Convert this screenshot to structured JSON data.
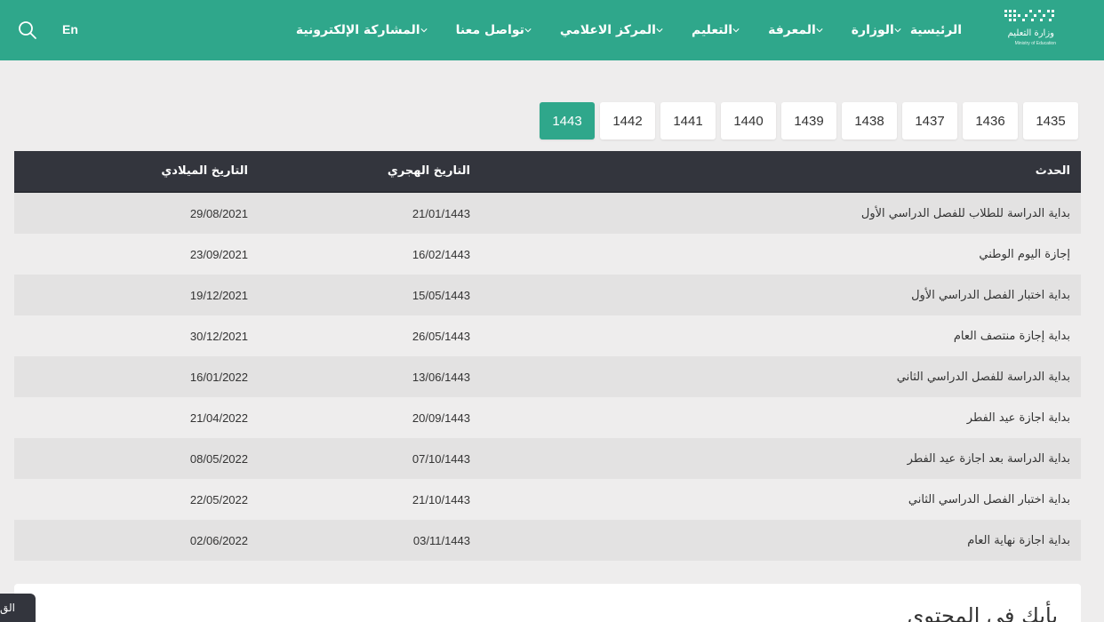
{
  "header": {
    "logo": {
      "arabic_text": "وزارة التعليم",
      "english_text": "Ministry of Education"
    },
    "nav": [
      {
        "label": "الرئيسية",
        "has_dropdown": false
      },
      {
        "label": "الوزارة",
        "has_dropdown": true
      },
      {
        "label": "المعرفة",
        "has_dropdown": true
      },
      {
        "label": "التعليم",
        "has_dropdown": true
      },
      {
        "label": "المركز الاعلامي",
        "has_dropdown": true
      },
      {
        "label": "تواصل معنا",
        "has_dropdown": true
      },
      {
        "label": "المشاركة الإلكترونية",
        "has_dropdown": true
      }
    ],
    "language_toggle": "En",
    "search_icon": "search-icon"
  },
  "years": {
    "items": [
      "1435",
      "1436",
      "1437",
      "1438",
      "1439",
      "1440",
      "1441",
      "1442",
      "1443"
    ],
    "active": "1443"
  },
  "table": {
    "headers": {
      "event": "الحدث",
      "hijri": "التاريخ الهجري",
      "gregorian": "التاريخ الميلادي"
    },
    "rows": [
      {
        "event": "بداية الدراسة للطلاب للفصل الدراسي الأول",
        "hijri": "21/01/1443",
        "gregorian": "29/08/2021"
      },
      {
        "event": "إجازة اليوم الوطني",
        "hijri": "16/02/1443",
        "gregorian": "23/09/2021"
      },
      {
        "event": "بداية اختبار الفصل الدراسي الأول",
        "hijri": "15/05/1443",
        "gregorian": "19/12/2021"
      },
      {
        "event": "بداية إجازة منتصف العام",
        "hijri": "26/05/1443",
        "gregorian": "30/12/2021"
      },
      {
        "event": "بداية الدراسة للفصل الدراسي الثاني",
        "hijri": "13/06/1443",
        "gregorian": "16/01/2022"
      },
      {
        "event": "بداية اجازة عيد الفطر",
        "hijri": "20/09/1443",
        "gregorian": "21/04/2022"
      },
      {
        "event": "بداية الدراسة بعد اجازة عيد الفطر",
        "hijri": "07/10/1443",
        "gregorian": "08/05/2022"
      },
      {
        "event": "بداية اختبار الفصل الدراسي الثاني",
        "hijri": "21/10/1443",
        "gregorian": "22/05/2022"
      },
      {
        "event": "بداية اجازة نهاية العام",
        "hijri": "03/11/1443",
        "gregorian": "02/06/2022"
      }
    ]
  },
  "opinion_section": {
    "title": "يأيك في المحتوى"
  },
  "side_tab": {
    "label": "الق"
  },
  "colors": {
    "primary": "#2fa78b",
    "table_header": "#33353d",
    "background": "#eeeded"
  }
}
